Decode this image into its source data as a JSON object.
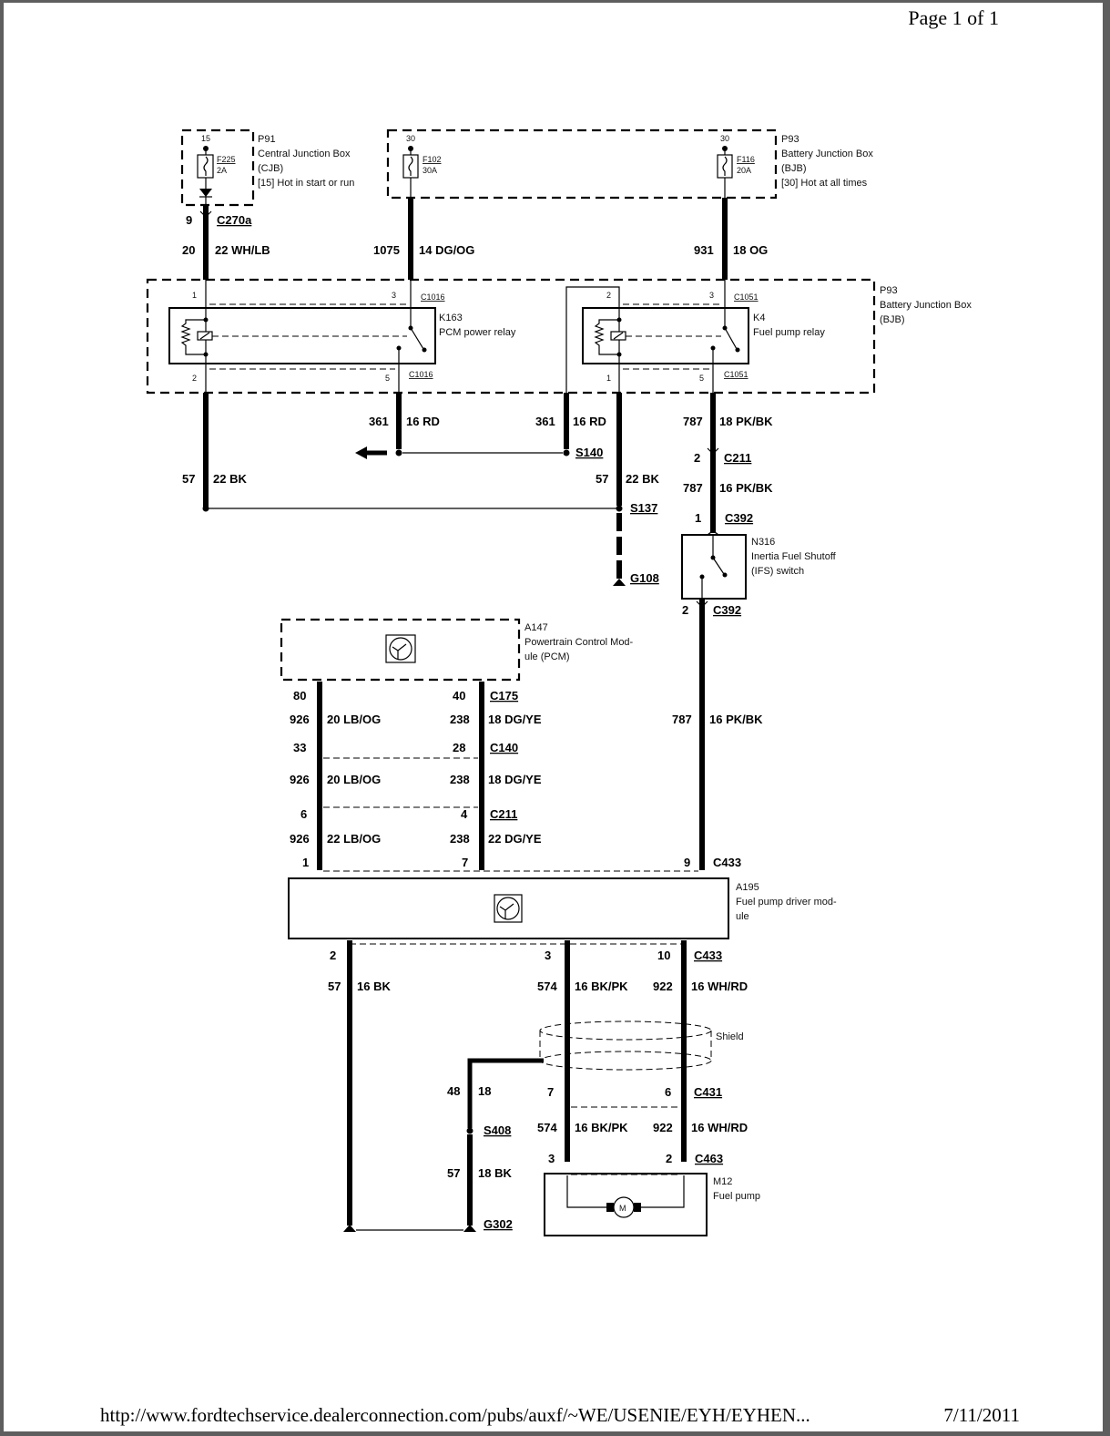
{
  "header": {
    "page_indicator": "Page 1 of 1"
  },
  "footer": {
    "url": "http://www.fordtechservice.dealerconnection.com/pubs/auxf/~WE/USENIE/EYH/EYHEN...",
    "date": "7/11/2011"
  },
  "components": {
    "p91": {
      "id": "P91",
      "name": "Central Junction Box",
      "abbr": "(CJB)",
      "note": "[15] Hot in start or run",
      "terminal": "15",
      "fuse": {
        "id": "F225",
        "rating": "2A"
      }
    },
    "p93_top": {
      "id": "P93",
      "name": "Battery Junction Box",
      "abbr": "(BJB)",
      "note": "[30] Hot at all times",
      "fuse_a": {
        "terminal": "30",
        "id": "F102",
        "rating": "30A"
      },
      "fuse_b": {
        "terminal": "30",
        "id": "F116",
        "rating": "20A"
      }
    },
    "p93_relays": {
      "id": "P93",
      "name": "Battery Junction Box",
      "abbr": "(BJB)"
    },
    "k163": {
      "id": "K163",
      "name": "PCM power relay",
      "connector": "C1016",
      "pins": [
        "1",
        "3",
        "2",
        "5"
      ]
    },
    "k4": {
      "id": "K4",
      "name": "Fuel pump relay",
      "connector": "C1051",
      "pins": [
        "2",
        "3",
        "1",
        "5"
      ]
    },
    "n316": {
      "id": "N316",
      "name": "Inertia Fuel Shutoff",
      "name2": "(IFS) switch"
    },
    "a147": {
      "id": "A147",
      "name": "Powertrain Control Mod-",
      "name2": "ule (PCM)"
    },
    "a195": {
      "id": "A195",
      "name": "Fuel pump driver mod-",
      "name2": "ule"
    },
    "m12": {
      "id": "M12",
      "name": "Fuel pump",
      "symbol": "M"
    },
    "shield": {
      "label": "Shield"
    }
  },
  "wires": {
    "w1": {
      "pin": "9",
      "connector": "C270a",
      "circuit": "20",
      "spec": "22 WH/LB"
    },
    "w2": {
      "circuit": "1075",
      "spec": "14 DG/OG"
    },
    "w3": {
      "circuit": "931",
      "spec": "18 OG"
    },
    "w4": {
      "circuit": "361",
      "spec": "16 RD"
    },
    "w5": {
      "circuit": "361",
      "spec": "16 RD",
      "splice": "S140"
    },
    "w6": {
      "circuit": "57",
      "spec": "22 BK"
    },
    "w7": {
      "circuit": "57",
      "spec": "22 BK",
      "splice": "S137",
      "ground": "G108"
    },
    "w8": {
      "circuit": "787",
      "spec": "18 PK/BK",
      "pin": "2",
      "connector": "C211"
    },
    "w9": {
      "circuit": "787",
      "spec": "16 PK/BK",
      "pin": "1",
      "connector": "C392"
    },
    "w10": {
      "pin": "2",
      "connector": "C392",
      "circuit": "787",
      "spec": "16 PK/BK",
      "pin_end": "9",
      "connector_end": "C433"
    },
    "pcm_left": {
      "pin_c175": "80",
      "circuit": "926",
      "spec1": "20 LB/OG",
      "pin_c140": "33",
      "spec2": "20 LB/OG",
      "pin_c211": "6",
      "spec3": "22 LB/OG",
      "pin_c433": "1"
    },
    "pcm_right": {
      "pin_c175": "40",
      "circuit": "238",
      "spec1": "18 DG/YE",
      "pin_c140": "28",
      "spec2": "18 DG/YE",
      "pin_c211": "4",
      "spec3": "22 DG/YE",
      "pin_c433": "7"
    },
    "conn_labels": {
      "c175": "C175",
      "c140": "C140",
      "c211": "C211",
      "c433": "C433"
    },
    "out_gnd": {
      "pin": "2",
      "circuit": "57",
      "spec": "16 BK"
    },
    "out_574": {
      "pin": "3",
      "circuit": "574",
      "spec": "16 BK/PK",
      "pin_c431": "7",
      "spec2": "16 BK/PK",
      "pin_c463": "3"
    },
    "out_922": {
      "pin": "10",
      "circuit": "922",
      "spec": "16 WH/RD",
      "pin_c431": "6",
      "spec2": "16 WH/RD",
      "pin_c463": "2",
      "connector": "C433"
    },
    "shield_drain": {
      "circuit": "48",
      "spec": "18",
      "splice": "S408"
    },
    "s408_gnd": {
      "circuit": "57",
      "spec": "18 BK",
      "ground": "G302"
    },
    "c431": "C431",
    "c463": "C463"
  }
}
